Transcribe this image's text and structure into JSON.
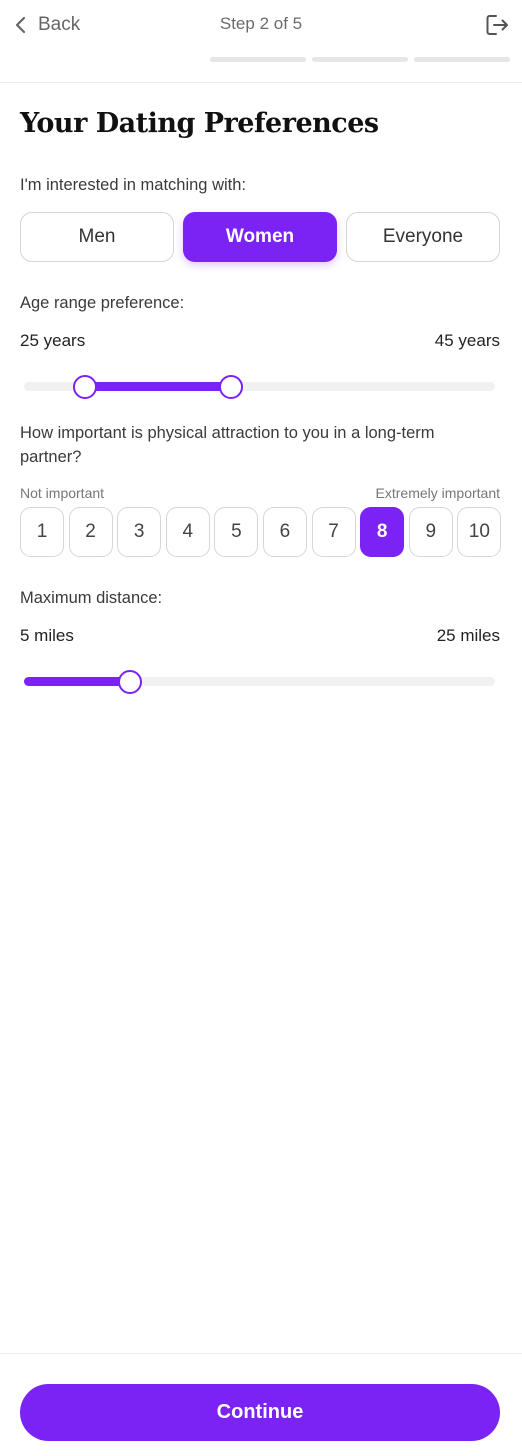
{
  "header": {
    "back_label": "Back",
    "step_label": "Step 2 of 5",
    "progress_segments": 3,
    "icons": {
      "back": "chevron-left-icon",
      "logout": "logout-icon"
    }
  },
  "title": "Your Dating Preferences",
  "gender": {
    "label": "I'm interested in matching with:",
    "options": [
      "Men",
      "Women",
      "Everyone"
    ],
    "selected": "Women"
  },
  "age": {
    "label": "Age range preference:",
    "min_label": "25 years",
    "max_label": "45 years",
    "low_fraction": 0.13,
    "high_fraction": 0.44
  },
  "attraction": {
    "question": "How important is physical attraction to you in a long-term partner?",
    "low_hint": "Not important",
    "high_hint": "Extremely important",
    "options": [
      "1",
      "2",
      "3",
      "4",
      "5",
      "6",
      "7",
      "8",
      "9",
      "10"
    ],
    "selected": "8"
  },
  "distance": {
    "label": "Maximum distance:",
    "min_label": "5 miles",
    "max_label": "25 miles",
    "fraction": 0.225
  },
  "footer": {
    "continue_label": "Continue"
  },
  "colors": {
    "accent": "#7b22f5",
    "track": "#f1f1f1",
    "border": "#d6d6d6"
  }
}
